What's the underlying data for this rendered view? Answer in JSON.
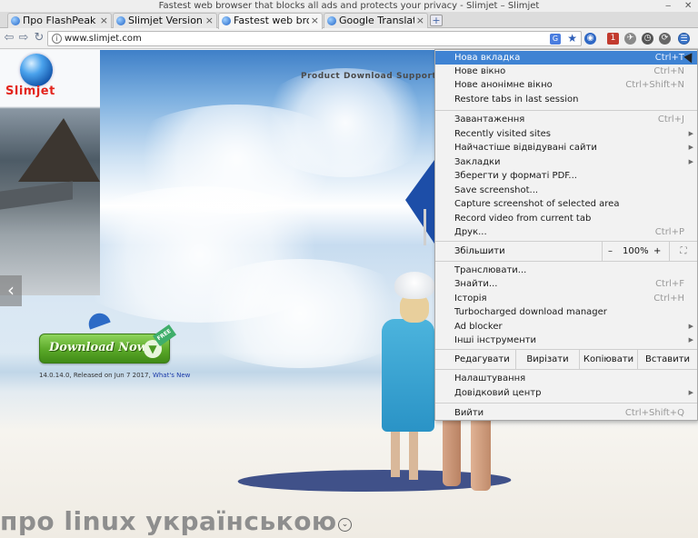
{
  "window": {
    "title": "Fastest web browser that blocks all ads and protects your privacy - Slimjet – Slimjet",
    "controls": [
      "‒",
      "✕"
    ]
  },
  "tabs": [
    {
      "label": "Про FlashPeak Sli",
      "active": false
    },
    {
      "label": "Slimjet Version Hi",
      "active": false
    },
    {
      "label": "Fastest web brows",
      "active": true
    },
    {
      "label": "Google Translate",
      "active": false
    }
  ],
  "new_tab_symbol": "+",
  "toolbar": {
    "url": "www.slimjet.com",
    "translate_badge": "G",
    "ext_badge": "1"
  },
  "site": {
    "logo_text": "Slimjet",
    "nav": [
      "Product",
      "Download",
      "Support"
    ],
    "download_label": "Download Now",
    "free_badge": "FREE",
    "release_text": "14.0.14.0, Released on Jun 7 2017,",
    "whats_new": "What's New",
    "footer_text": "про linux українською"
  },
  "menu": {
    "group1": [
      {
        "label": "Нова вкладка",
        "shortcut": "Ctrl+T",
        "highlighted": true
      },
      {
        "label": "Нове вікно",
        "shortcut": "Ctrl+N"
      },
      {
        "label": "Нове анонімне вікно",
        "shortcut": "Ctrl+Shift+N"
      },
      {
        "label": "Restore tabs in last session",
        "shortcut": ""
      }
    ],
    "group2": [
      {
        "label": "Завантаження",
        "shortcut": "Ctrl+J",
        "submenu": false
      },
      {
        "label": "Recently visited sites",
        "shortcut": "",
        "submenu": true
      },
      {
        "label": "Найчастіше відвідувані сайти",
        "shortcut": "",
        "submenu": true
      },
      {
        "label": "Закладки",
        "shortcut": "",
        "submenu": true
      },
      {
        "label": "Зберегти у форматі PDF...",
        "shortcut": "",
        "submenu": false
      },
      {
        "label": "Save screenshot...",
        "shortcut": "",
        "submenu": false
      },
      {
        "label": "Capture screenshot of selected area",
        "shortcut": "",
        "submenu": false
      },
      {
        "label": "Record video from current tab",
        "shortcut": "",
        "submenu": false
      },
      {
        "label": "Друк...",
        "shortcut": "Ctrl+P",
        "submenu": false
      }
    ],
    "zoom": {
      "label": "Збільшити",
      "minus": "–",
      "value": "100%",
      "plus": "+",
      "fullscreen": "⛶"
    },
    "group3": [
      {
        "label": "Транслювати...",
        "shortcut": "",
        "submenu": false
      },
      {
        "label": "Знайти...",
        "shortcut": "Ctrl+F",
        "submenu": false
      },
      {
        "label": "Історія",
        "shortcut": "Ctrl+H",
        "submenu": false
      },
      {
        "label": "Turbocharged download manager",
        "shortcut": "",
        "submenu": false
      },
      {
        "label": "Ad blocker",
        "shortcut": "",
        "submenu": true
      },
      {
        "label": "Інші інструменти",
        "shortcut": "",
        "submenu": true
      }
    ],
    "edit": {
      "label": "Редагувати",
      "cut": "Вирізати",
      "copy": "Копіювати",
      "paste": "Вставити"
    },
    "group4": [
      {
        "label": "Налаштування",
        "shortcut": "",
        "submenu": false
      },
      {
        "label": "Довідковий центр",
        "shortcut": "",
        "submenu": true
      }
    ],
    "exit": {
      "label": "Вийти",
      "shortcut": "Ctrl+Shift+Q"
    }
  },
  "colors": {
    "menu_highlight": "#3f83d3",
    "logo_red": "#e3251d",
    "download_green": "#5aa828"
  },
  "icons": {
    "back": "back-arrow-icon",
    "forward": "forward-arrow-icon",
    "reload": "reload-icon",
    "bookmark": "star-icon",
    "menu": "wrench-menu-icon"
  }
}
